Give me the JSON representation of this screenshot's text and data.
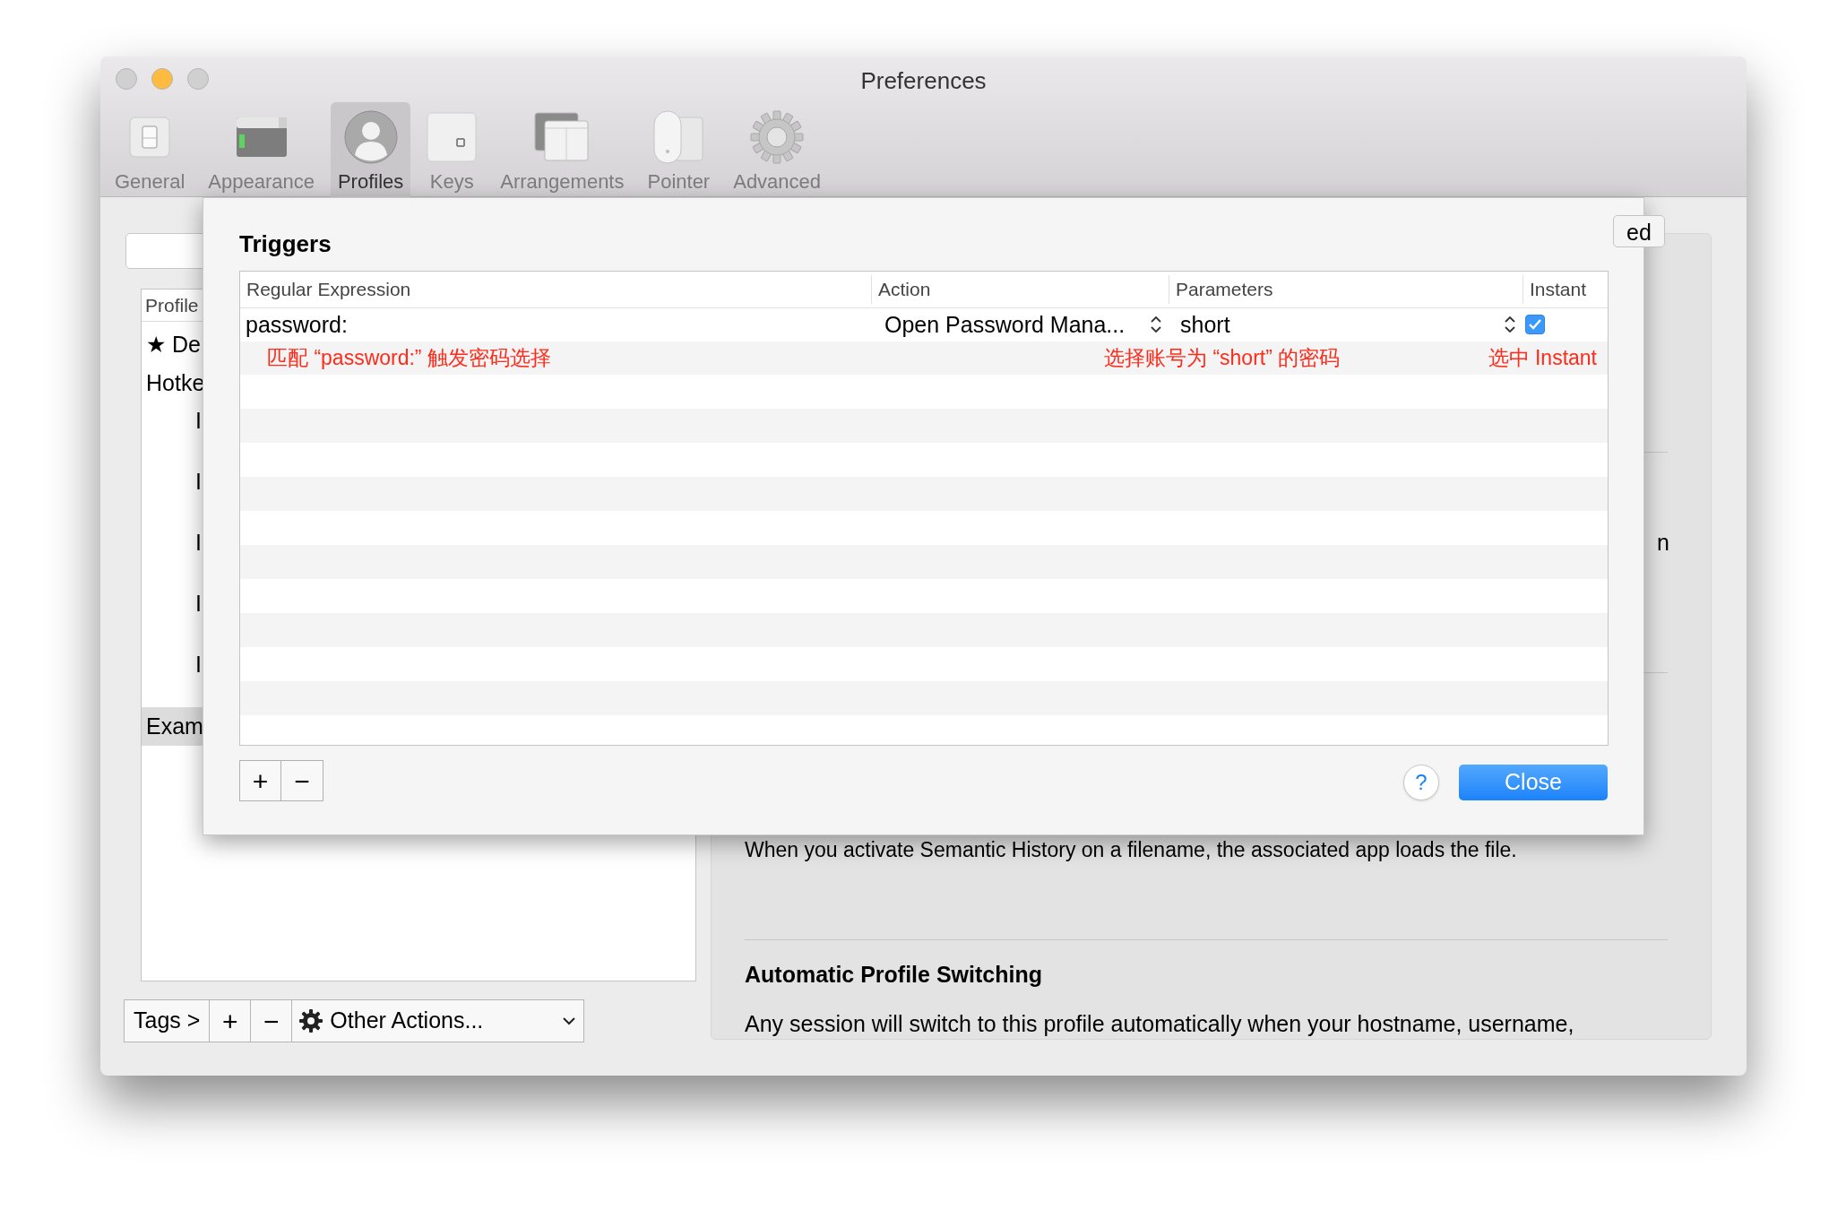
{
  "window": {
    "title": "Preferences",
    "controls": [
      {
        "color": "#d0d0d0"
      },
      {
        "color": "#fdbc40"
      },
      {
        "color": "#d0d0d0"
      }
    ]
  },
  "toolbar": [
    {
      "kind": "general",
      "label": "General",
      "selected": false
    },
    {
      "kind": "appearance",
      "label": "Appearance",
      "selected": false
    },
    {
      "kind": "profiles",
      "label": "Profiles",
      "selected": true
    },
    {
      "kind": "keys",
      "label": "Keys",
      "selected": false
    },
    {
      "kind": "arrangements",
      "label": "Arrangements",
      "selected": false
    },
    {
      "kind": "pointer",
      "label": "Pointer",
      "selected": false
    },
    {
      "kind": "advanced",
      "label": "Advanced",
      "selected": false
    }
  ],
  "profile_list": {
    "header": "Profile",
    "items": [
      {
        "label": "★ De",
        "selected": false
      },
      {
        "label": "Hotke",
        "selected": false,
        "children": [
          {
            "label": "I",
            "selected": false
          },
          {
            "label": "I",
            "selected": false
          },
          {
            "label": "I",
            "selected": false
          },
          {
            "label": "I",
            "selected": false
          },
          {
            "label": "I",
            "selected": false
          }
        ]
      },
      {
        "label": "Exam",
        "selected": true
      }
    ]
  },
  "bottom_bar": {
    "tags": "Tags >",
    "add": "+",
    "remove": "−",
    "actions": "Other Actions..."
  },
  "tab_stub": "ed",
  "details": {
    "fragment": "n",
    "semantic_text": "When you activate Semantic History on a filename, the associated app loads the file.",
    "section_title": "Automatic Profile Switching",
    "section_text": "Any session will switch to this profile automatically when your hostname, username,"
  },
  "triggers": {
    "title": "Triggers",
    "columns": [
      "Regular Expression",
      "Action",
      "Parameters",
      "Instant"
    ],
    "rows": [
      {
        "regex": "password:",
        "action": "Open Password Mana...",
        "parameters": "short",
        "instant": true
      }
    ],
    "annotations": [
      "匹配 “password:” 触发密码选择",
      "选择账号为 “short” 的密码",
      "选中 Instant"
    ],
    "add": "+",
    "remove": "−",
    "help": "?",
    "close": "Close"
  }
}
